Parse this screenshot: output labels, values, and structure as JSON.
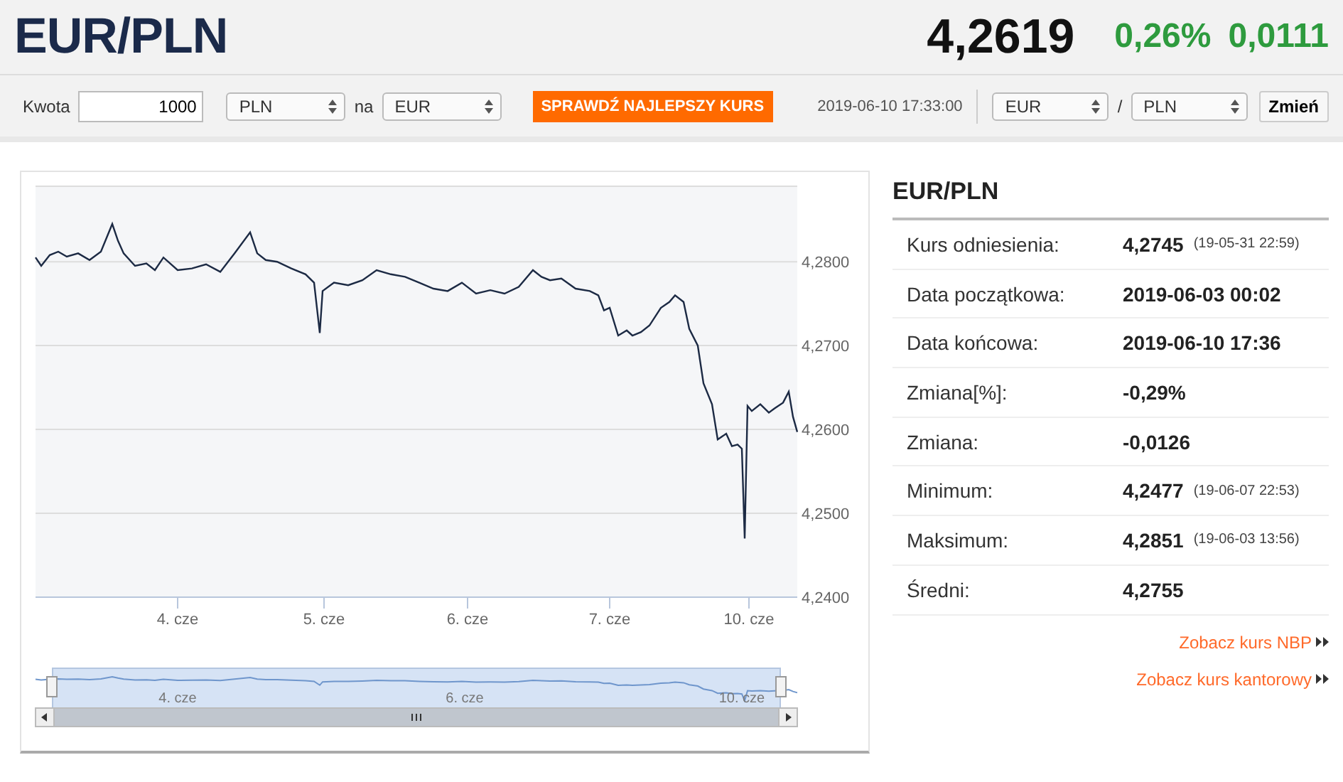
{
  "header": {
    "title": "EUR/PLN",
    "rate": "4,2619",
    "change_percent": "0,26%",
    "change": "0,0111"
  },
  "toolbar": {
    "amount_label": "Kwota",
    "amount": "1000",
    "from_currency": "PLN",
    "to_label": "na",
    "to_currency": "EUR",
    "check_button": "SPRAWDŹ NAJLEPSZY KURS",
    "timestamp": "2019-06-10 17:33:00",
    "pair_base": "EUR",
    "pair_separator": "/",
    "pair_quote": "PLN",
    "swap_button": "Zmień"
  },
  "chart": {
    "y_labels": [
      "4,2800",
      "4,2700",
      "4,2600",
      "4,2500",
      "4,2400"
    ],
    "x_labels": [
      "4. cze",
      "5. cze",
      "6. cze",
      "7. cze",
      "10. cze"
    ],
    "navigator_labels": [
      "4. cze",
      "6. cze",
      "10. cze"
    ]
  },
  "stats": {
    "title": "EUR/PLN",
    "rows": [
      {
        "label": "Kurs odniesienia:",
        "value": "4,2745",
        "note": "(19-05-31 22:59)"
      },
      {
        "label": "Data początkowa:",
        "value": "2019-06-03 00:02"
      },
      {
        "label": "Data końcowa:",
        "value": "2019-06-10 17:36"
      },
      {
        "label": "Zmiana[%]:",
        "value": "-0,29%"
      },
      {
        "label": "Zmiana:",
        "value": "-0,0126"
      },
      {
        "label": "Minimum:",
        "value": "4,2477",
        "note": "(19-06-07 22:53)"
      },
      {
        "label": "Maksimum:",
        "value": "4,2851",
        "note": "(19-06-03 13:56)"
      },
      {
        "label": "Średni:",
        "value": "4,2755"
      }
    ],
    "links": [
      "Zobacz kurs NBP",
      "Zobacz kurs kantorowy"
    ]
  }
}
